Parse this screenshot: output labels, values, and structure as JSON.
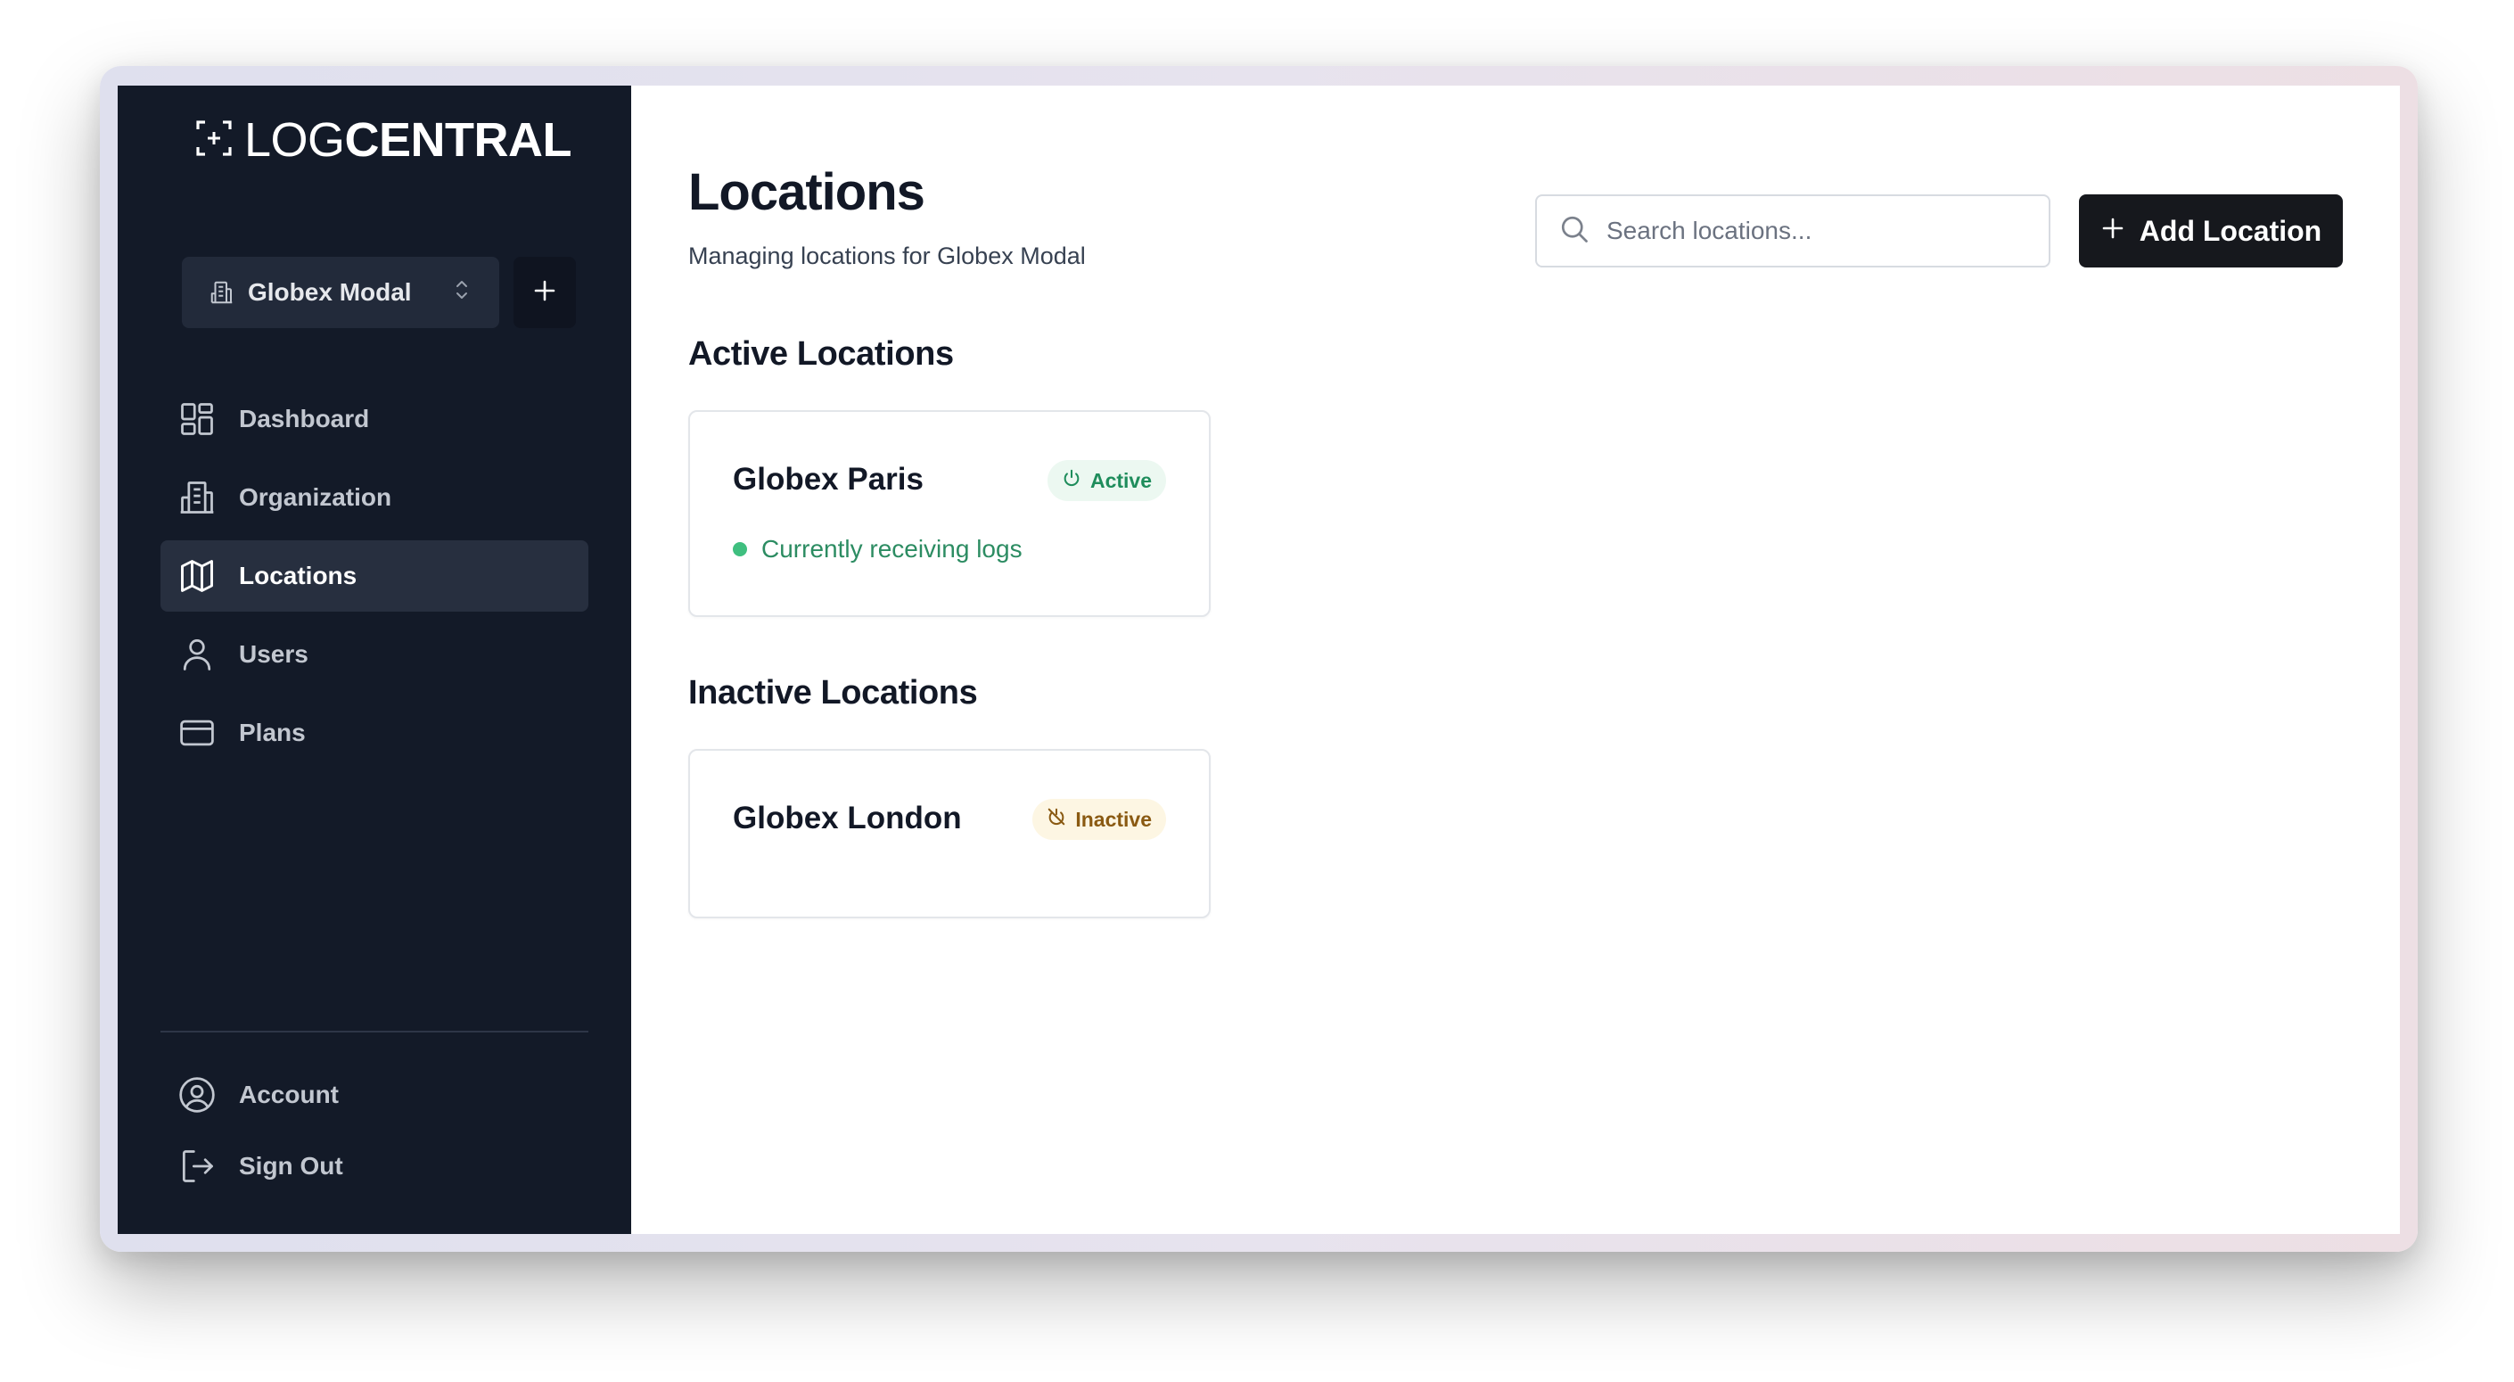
{
  "app": {
    "logo_light": "LOG",
    "logo_bold": "CENTRAL"
  },
  "org_switcher": {
    "selected": "Globex Modal",
    "add_label": "+"
  },
  "nav": {
    "items": [
      {
        "label": "Dashboard",
        "icon": "dashboard-icon",
        "active": false
      },
      {
        "label": "Organization",
        "icon": "building-icon",
        "active": false
      },
      {
        "label": "Locations",
        "icon": "map-icon",
        "active": true
      },
      {
        "label": "Users",
        "icon": "user-icon",
        "active": false
      },
      {
        "label": "Plans",
        "icon": "credit-card-icon",
        "active": false
      }
    ],
    "bottom": [
      {
        "label": "Account",
        "icon": "user-circle-icon"
      },
      {
        "label": "Sign Out",
        "icon": "sign-out-icon"
      }
    ]
  },
  "header": {
    "title": "Locations",
    "subtitle": "Managing locations for Globex Modal"
  },
  "search": {
    "placeholder": "Search locations...",
    "value": ""
  },
  "actions": {
    "add_location": "Add Location"
  },
  "sections": {
    "active_title": "Active Locations",
    "inactive_title": "Inactive Locations"
  },
  "locations": {
    "active": [
      {
        "name": "Globex Paris",
        "badge": "Active",
        "status": "Currently receiving logs"
      }
    ],
    "inactive": [
      {
        "name": "Globex London",
        "badge": "Inactive"
      }
    ]
  },
  "colors": {
    "sidebar_bg": "#131a28",
    "active_badge_text": "#1f8d5c",
    "inactive_badge_text": "#8a5a12",
    "primary_button": "#16181d"
  }
}
